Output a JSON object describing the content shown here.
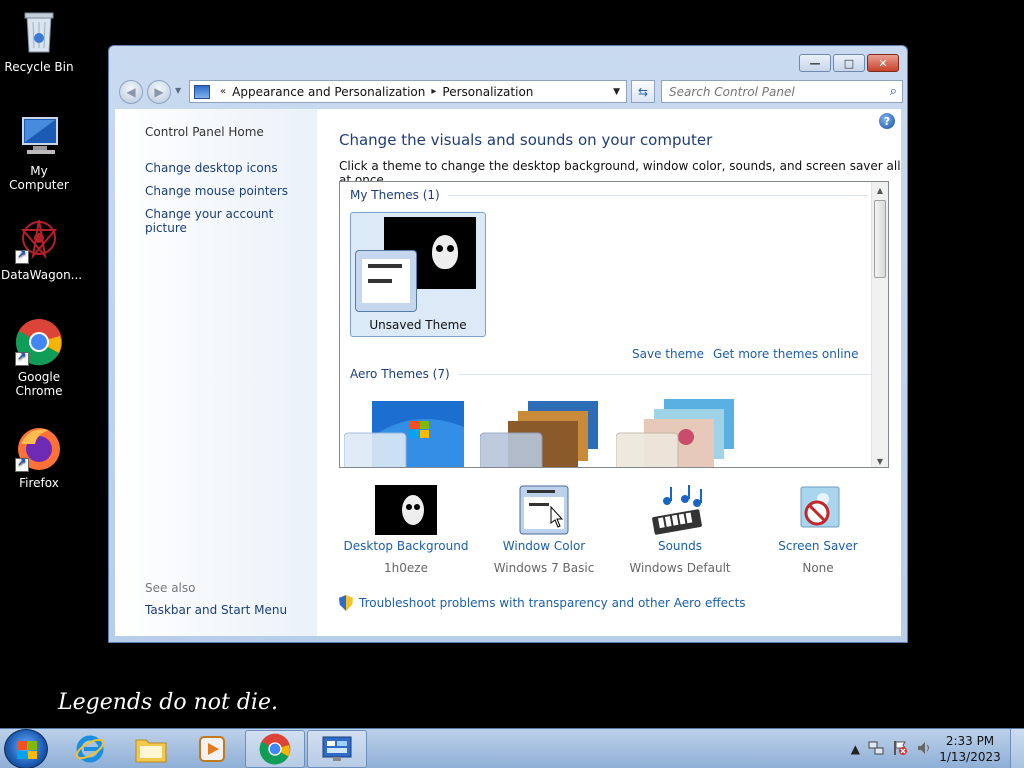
{
  "desktop": {
    "icons": [
      {
        "label": "Recycle Bin"
      },
      {
        "label": "My Computer"
      },
      {
        "label": "DataWagon..."
      },
      {
        "label": "Google Chrome"
      },
      {
        "label": "Firefox"
      }
    ],
    "quote": "Legends do not die."
  },
  "window": {
    "controls": {
      "minimize": "—",
      "maximize": "□",
      "close": "✕"
    },
    "breadcrumb": {
      "prefix": "«",
      "items": [
        "Appearance and Personalization",
        "Personalization"
      ],
      "separator": "▸"
    },
    "search_placeholder": "Search Control Panel",
    "left_pane": {
      "home": "Control Panel Home",
      "links": [
        "Change desktop icons",
        "Change mouse pointers",
        "Change your account picture"
      ],
      "see_also_label": "See also",
      "see_also_links": [
        "Taskbar and Start Menu"
      ]
    },
    "main": {
      "title": "Change the visuals and sounds on your computer",
      "subtitle": "Click a theme to change the desktop background, window color, sounds, and screen saver all at once.",
      "my_themes_label": "My Themes (1)",
      "selected_theme": "Unsaved Theme",
      "save_theme": "Save theme",
      "get_more": "Get more themes online",
      "aero_label": "Aero Themes (7)",
      "options": [
        {
          "label": "Desktop Background",
          "value": "1h0eze"
        },
        {
          "label": "Window Color",
          "value": "Windows 7 Basic"
        },
        {
          "label": "Sounds",
          "value": "Windows Default"
        },
        {
          "label": "Screen Saver",
          "value": "None"
        }
      ],
      "troubleshoot": "Troubleshoot problems with transparency and other Aero effects",
      "help": "?"
    }
  },
  "taskbar": {
    "clock_time": "2:33 PM",
    "clock_date": "1/13/2023",
    "tray_arrow": "▲"
  },
  "colors": {
    "link": "#1b5fab",
    "title": "#1e3e7a",
    "window_frame": "#b7cde9"
  }
}
